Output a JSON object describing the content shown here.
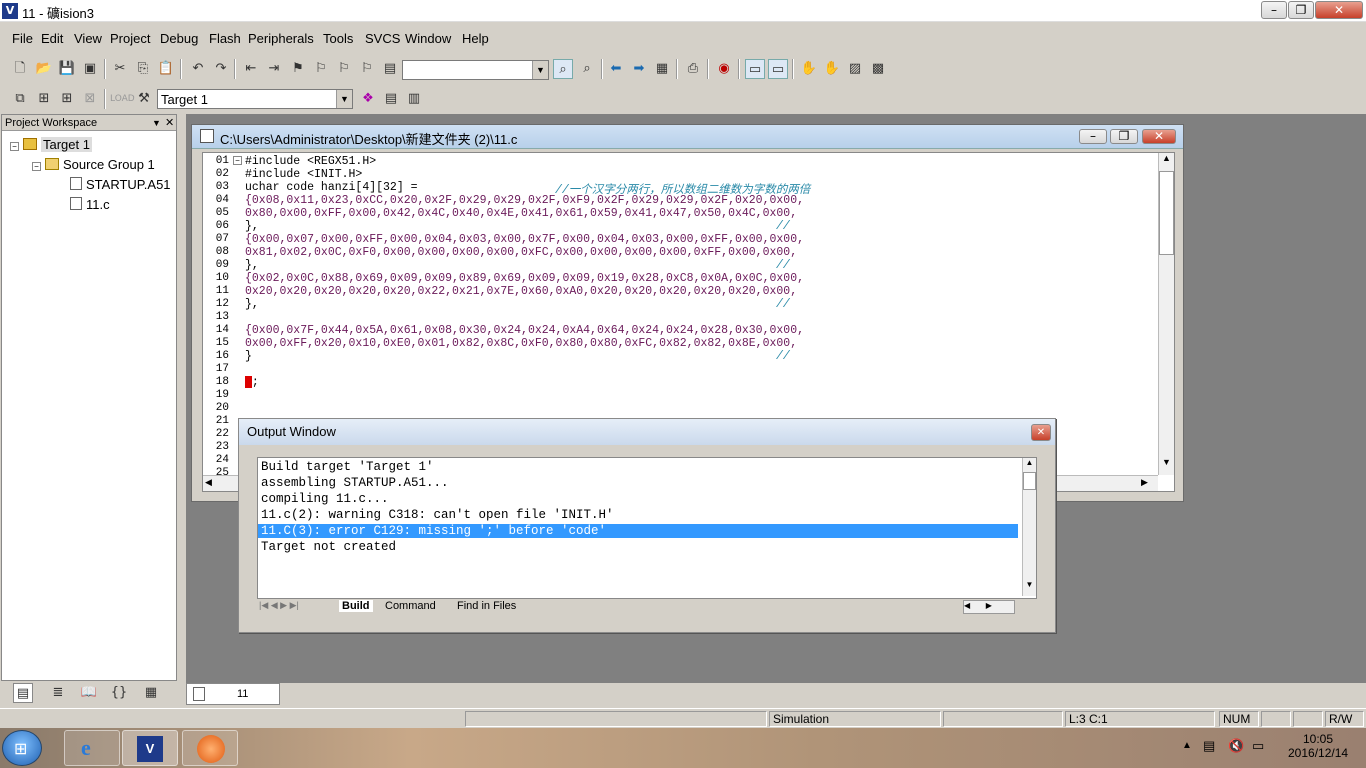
{
  "window": {
    "title": "11  - 礦ision3",
    "app_icon": "V"
  },
  "menu": [
    "File",
    "Edit",
    "View",
    "Project",
    "Debug",
    "Flash",
    "Peripherals",
    "Tools",
    "SVCS",
    "Window",
    "Help"
  ],
  "toolbar2": {
    "target_value": "Target 1"
  },
  "workspace": {
    "title": "Project Workspace",
    "tree": {
      "root": "Target 1",
      "group": "Source Group 1",
      "files": [
        "STARTUP.A51",
        "11.c"
      ]
    }
  },
  "editor": {
    "title": "C:\\Users\\Administrator\\Desktop\\新建文件夹 (2)\\11.c",
    "lines": [
      {
        "n": "01",
        "t": "#include <REGX51.H>",
        "c": ""
      },
      {
        "n": "02",
        "t": "#include <INIT.H>",
        "c": ""
      },
      {
        "n": "03",
        "t": "uchar code hanzi[4][32] =",
        "c": "//一个汉字分两行，所以数组二维数为字数的两倍"
      },
      {
        "n": "04",
        "t": "{0x08,0x11,0x23,0xCC,0x20,0x2F,0x29,0x29,0x2F,0xF9,0x2F,0x29,0x29,0x2F,0x20,0x00,",
        "c": ""
      },
      {
        "n": "05",
        "t": "0x80,0x00,0xFF,0x00,0x42,0x4C,0x40,0x4E,0x41,0x61,0x59,0x41,0x47,0x50,0x4C,0x00,",
        "c": ""
      },
      {
        "n": "06",
        "t": "},",
        "c": "//"
      },
      {
        "n": "07",
        "t": "{0x00,0x07,0x00,0xFF,0x00,0x04,0x03,0x00,0x7F,0x00,0x04,0x03,0x00,0xFF,0x00,0x00,",
        "c": ""
      },
      {
        "n": "08",
        "t": "0x81,0x02,0x0C,0xF0,0x00,0x00,0x00,0x00,0xFC,0x00,0x00,0x00,0x00,0xFF,0x00,0x00,",
        "c": ""
      },
      {
        "n": "09",
        "t": "},",
        "c": "//"
      },
      {
        "n": "10",
        "t": "{0x02,0x0C,0x88,0x69,0x09,0x09,0x89,0x69,0x09,0x09,0x19,0x28,0xC8,0x0A,0x0C,0x00,",
        "c": ""
      },
      {
        "n": "11",
        "t": "0x20,0x20,0x20,0x20,0x20,0x22,0x21,0x7E,0x60,0xA0,0x20,0x20,0x20,0x20,0x20,0x00,",
        "c": ""
      },
      {
        "n": "12",
        "t": "},",
        "c": "//"
      },
      {
        "n": "13",
        "t": "",
        "c": ""
      },
      {
        "n": "14",
        "t": "{0x00,0x7F,0x44,0x5A,0x61,0x08,0x30,0x24,0x24,0xA4,0x64,0x24,0x24,0x28,0x30,0x00,",
        "c": ""
      },
      {
        "n": "15",
        "t": "0x00,0xFF,0x20,0x10,0xE0,0x01,0x82,0x8C,0xF0,0x80,0x80,0xFC,0x82,0x82,0x8E,0x00,",
        "c": ""
      },
      {
        "n": "16",
        "t": "}",
        "c": "//"
      },
      {
        "n": "17",
        "t": "",
        "c": ""
      },
      {
        "n": "18",
        "t": " ;",
        "c": ""
      },
      {
        "n": "19",
        "t": "",
        "c": ""
      },
      {
        "n": "20",
        "t": "",
        "c": ""
      },
      {
        "n": "21",
        "t": "",
        "c": ""
      },
      {
        "n": "22",
        "t": "",
        "c": ""
      },
      {
        "n": "23",
        "t": "",
        "c": ""
      },
      {
        "n": "24",
        "t": "",
        "c": ""
      },
      {
        "n": "25",
        "t": "",
        "c": ""
      }
    ]
  },
  "output": {
    "title": "Output Window",
    "lines": [
      "Build target 'Target 1'",
      "assembling STARTUP.A51...",
      "compiling 11.c...",
      "11.c(2): warning C318: can't open file 'INIT.H'",
      "11.C(3): error C129: missing ';' before 'code'",
      "Target not created"
    ],
    "selected_index": 4,
    "tabs": [
      "Build",
      "Command",
      "Find in Files"
    ]
  },
  "doc_tab": "11",
  "status": {
    "mode": "Simulation",
    "position": "L:3 C:1",
    "num": "NUM",
    "rw": "R/W"
  },
  "clock": {
    "time": "10:05",
    "date": "2016/12/14"
  }
}
